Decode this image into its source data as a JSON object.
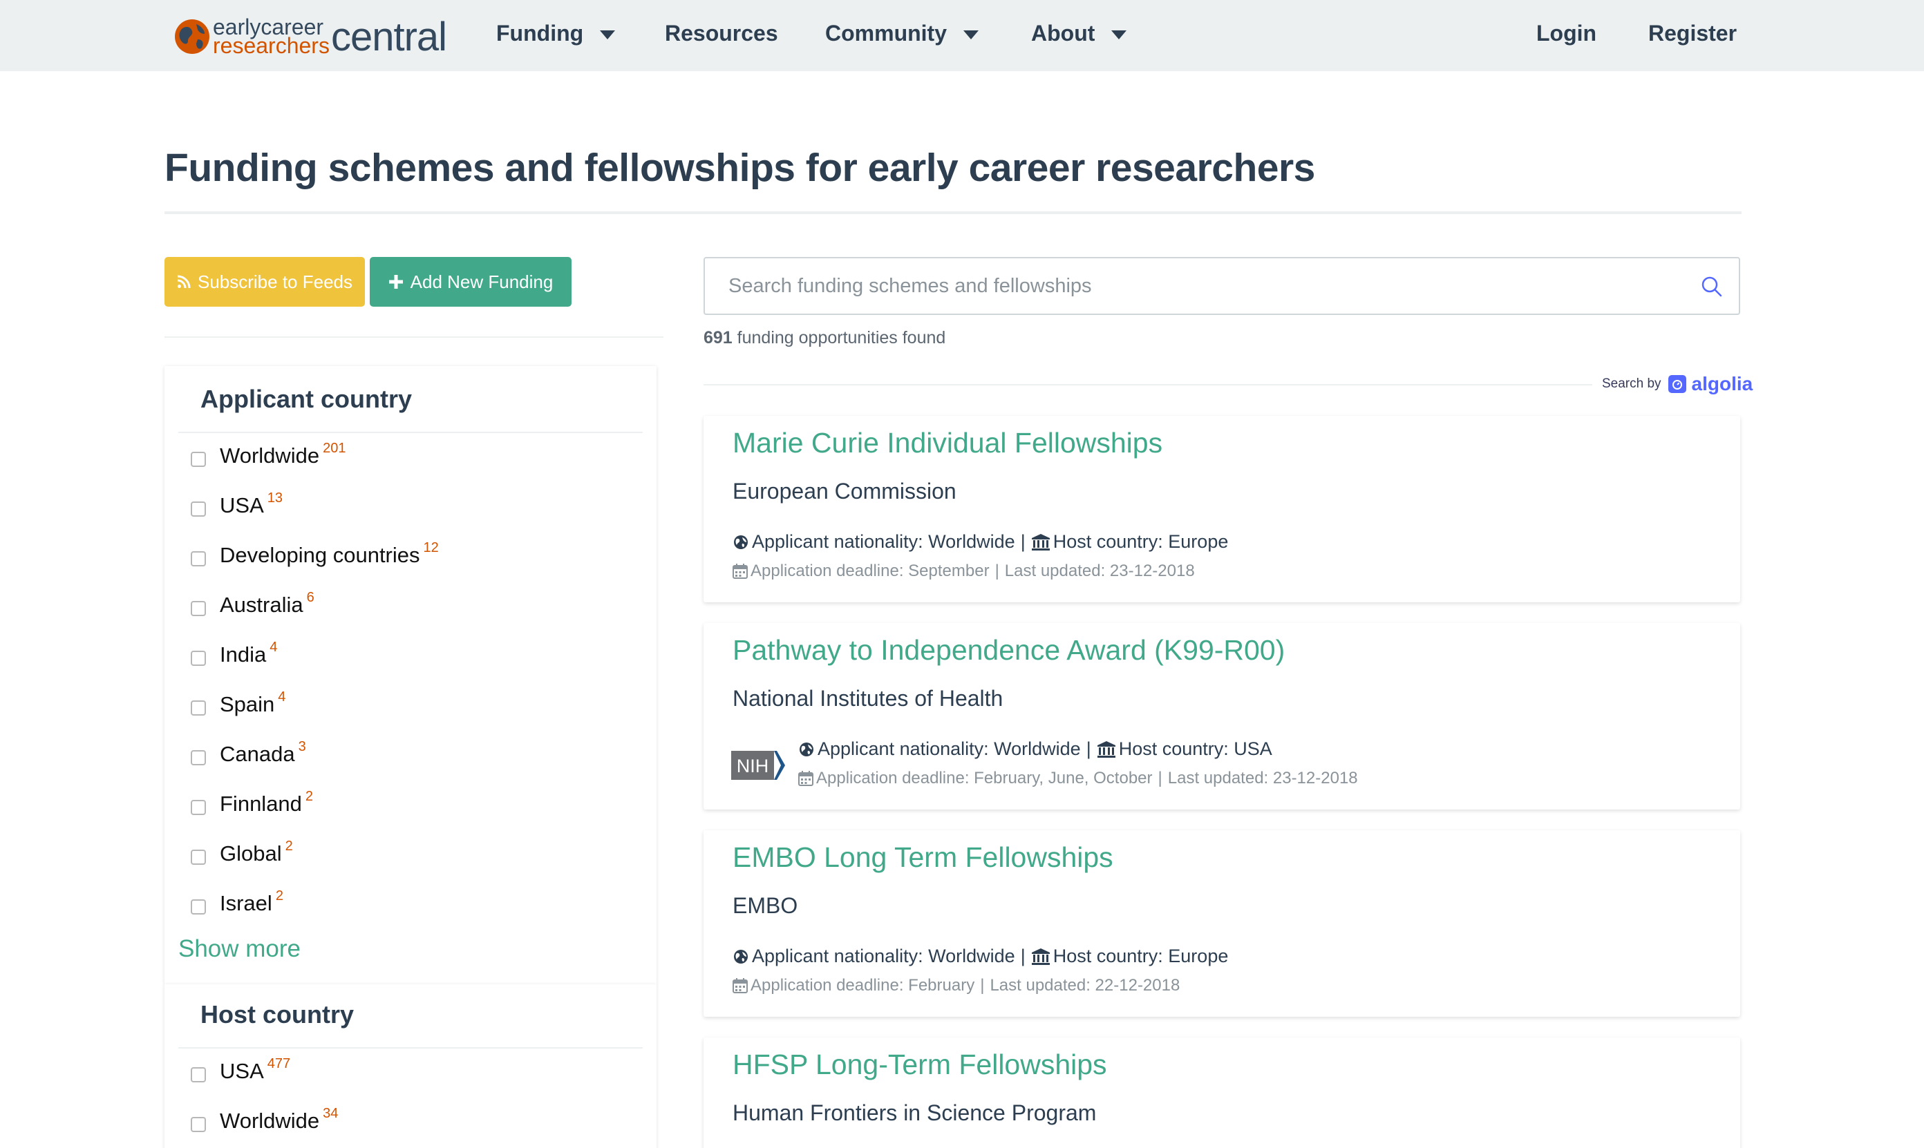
{
  "nav": {
    "logo": {
      "small_top": "earlycareer",
      "small_bottom": "researchers",
      "big": "central"
    },
    "items": [
      {
        "label": "Funding",
        "has_caret": true
      },
      {
        "label": "Resources",
        "has_caret": false
      },
      {
        "label": "Community",
        "has_caret": true
      },
      {
        "label": "About",
        "has_caret": true
      }
    ],
    "login": "Login",
    "register": "Register"
  },
  "page": {
    "title": "Funding schemes and fellowships for early career researchers"
  },
  "buttons": {
    "subscribe": "Subscribe to Feeds",
    "add": "Add New Funding"
  },
  "facets": {
    "applicant": {
      "title": "Applicant country",
      "items": [
        {
          "label": "Worldwide",
          "count": "201"
        },
        {
          "label": "USA",
          "count": "13"
        },
        {
          "label": "Developing countries",
          "count": "12"
        },
        {
          "label": "Australia",
          "count": "6"
        },
        {
          "label": "India",
          "count": "4"
        },
        {
          "label": "Spain",
          "count": "4"
        },
        {
          "label": "Canada",
          "count": "3"
        },
        {
          "label": "Finnland",
          "count": "2"
        },
        {
          "label": "Global",
          "count": "2"
        },
        {
          "label": "Israel",
          "count": "2"
        }
      ],
      "show_more": "Show more"
    },
    "host": {
      "title": "Host country",
      "items": [
        {
          "label": "USA",
          "count": "477"
        },
        {
          "label": "Worldwide",
          "count": "34"
        }
      ]
    }
  },
  "search": {
    "placeholder": "Search funding schemes and fellowships",
    "count": "691",
    "count_suffix": "funding opportunities found",
    "search_by": "Search by",
    "provider": "algolia"
  },
  "results": [
    {
      "title": "Marie Curie Individual Fellowships",
      "org": "European Commission",
      "nationality": "Applicant nationality: Worldwide",
      "host": "Host country: Europe",
      "deadline": "Application deadline: September",
      "updated": "Last updated: 23-12-2018",
      "has_logo": false
    },
    {
      "title": "Pathway to Independence Award (K99-R00)",
      "org": "National Institutes of Health",
      "nationality": "Applicant nationality: Worldwide",
      "host": "Host country: USA",
      "deadline": "Application deadline: February, June, October",
      "updated": "Last updated: 23-12-2018",
      "has_logo": true,
      "logo_text": "NIH"
    },
    {
      "title": "EMBO Long Term Fellowships",
      "org": "EMBO",
      "nationality": "Applicant nationality: Worldwide",
      "host": "Host country: Europe",
      "deadline": "Application deadline: February",
      "updated": "Last updated: 22-12-2018",
      "has_logo": false
    },
    {
      "title": "HFSP Long-Term Fellowships",
      "org": "Human Frontiers in Science Program"
    }
  ],
  "separator": "|",
  "colors": {
    "accent_green": "#41a98a",
    "subscribe_yellow": "#f0c33c",
    "count_orange": "#d35400",
    "nav_bg": "#ecf0f1",
    "algolia_blue": "#5468ff"
  },
  "icons": [
    "globe-icon",
    "bank-icon",
    "calendar-icon",
    "rss-icon",
    "plus-icon",
    "search-icon",
    "caret-down-icon"
  ]
}
